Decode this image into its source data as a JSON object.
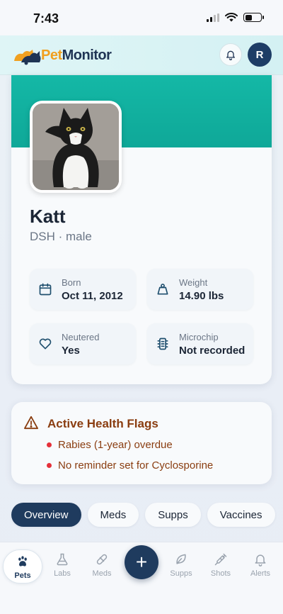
{
  "status_bar": {
    "time": "7:43"
  },
  "header": {
    "logo_pet": "Pet",
    "logo_monitor": "Monitor",
    "avatar_initial": "R"
  },
  "pet": {
    "name": "Katt",
    "breed_sex": "DSH · male"
  },
  "details": [
    {
      "icon": "calendar-icon",
      "label": "Born",
      "value": "Oct 11, 2012"
    },
    {
      "icon": "weight-icon",
      "label": "Weight",
      "value": "14.90 lbs"
    },
    {
      "icon": "heart-icon",
      "label": "Neutered",
      "value": "Yes"
    },
    {
      "icon": "microchip-icon",
      "label": "Microchip",
      "value": "Not recorded"
    }
  ],
  "health_flags": {
    "title": "Active Health Flags",
    "items": [
      "Rabies (1-year) overdue",
      "No reminder set for Cyclosporine"
    ]
  },
  "tabs": [
    {
      "label": "Overview",
      "active": true
    },
    {
      "label": "Meds"
    },
    {
      "label": "Supps"
    },
    {
      "label": "Vaccines"
    }
  ],
  "bottom_nav": [
    {
      "label": "Pets",
      "icon": "paw-icon",
      "active": true
    },
    {
      "label": "Labs",
      "icon": "flask-icon"
    },
    {
      "label": "Meds",
      "icon": "pill-icon"
    },
    {
      "label": "Supps",
      "icon": "leaf-icon"
    },
    {
      "label": "Shots",
      "icon": "syringe-icon"
    },
    {
      "label": "Alerts",
      "icon": "bell-icon"
    }
  ],
  "fab_symbol": "+",
  "colors": {
    "accent_teal": "#14b8a6",
    "navy": "#1f3b5e",
    "warning_text": "#8a3d10",
    "flag_dot": "#e5303a"
  }
}
